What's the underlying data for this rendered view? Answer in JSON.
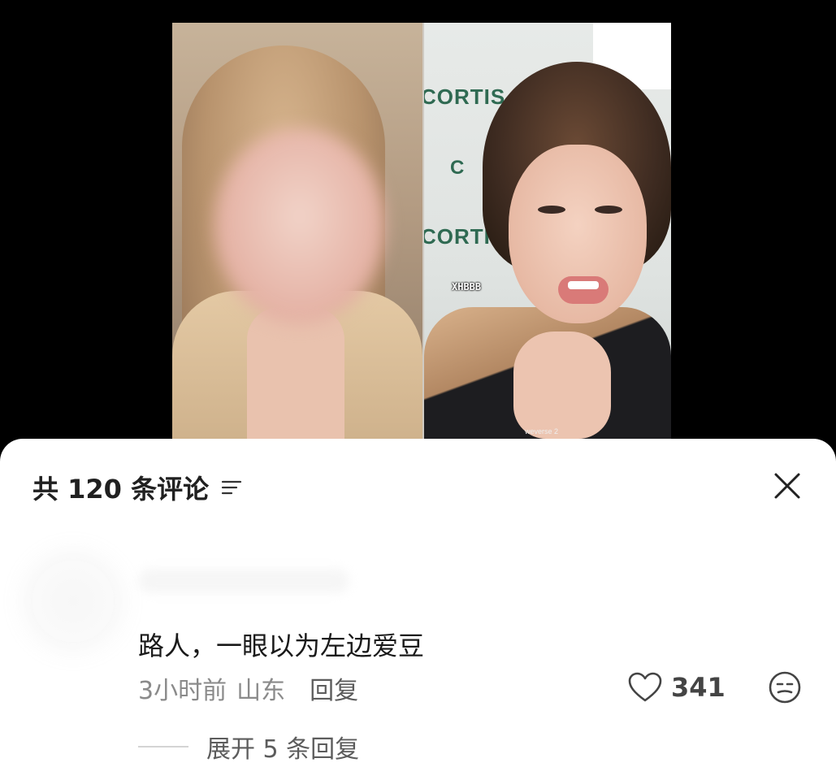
{
  "video": {
    "wall_logo_text": "CORTIS",
    "wall_logo_short": "C",
    "watermark": "XHBBB",
    "source_tag": "weverse 2"
  },
  "comments_panel": {
    "count_title": "共 120 条评论",
    "sort_icon": "sort-lines-icon",
    "close_icon": "close-x-icon"
  },
  "comment": {
    "text": "路人，一眼以为左边爱豆",
    "time": "3小时前",
    "location": "山东",
    "reply_label": "回复",
    "like_icon": "heart-outline-icon",
    "like_count": "341",
    "emoji_icon": "emoji-face-icon",
    "expand_label": "展开 5 条回复"
  },
  "colors": {
    "sheet_bg": "#ffffff",
    "primary_text": "#1a1a1a",
    "secondary_text": "#8a8a8a",
    "video_bg": "#000000",
    "logo_green": "#2f6a52"
  }
}
